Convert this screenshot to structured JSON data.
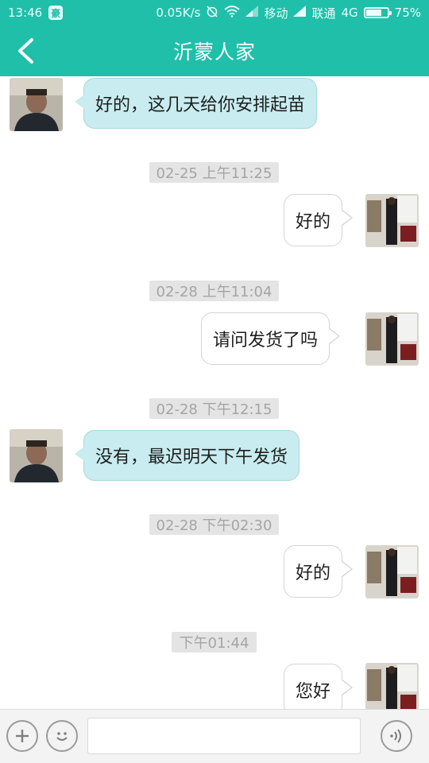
{
  "status_bar": {
    "time": "13:46",
    "app_badge": "豪",
    "network_speed": "0.05K/s",
    "carrier1": "移动",
    "carrier2": "联通",
    "network_type": "4G",
    "battery": "75%",
    "battery_level": 0.75,
    "icons": [
      "alarm-off-icon",
      "wifi-icon",
      "signal-icon",
      "signal-icon",
      "battery-icon"
    ]
  },
  "header": {
    "title": "沂蒙人家",
    "back_icon": "chevron-left-icon"
  },
  "messages": [
    {
      "kind": "in",
      "text": "好的，这几天给你安排起苗"
    },
    {
      "kind": "time",
      "text": "02-25 上午11:25"
    },
    {
      "kind": "out",
      "text": "好的"
    },
    {
      "kind": "time",
      "text": "02-28 上午11:04"
    },
    {
      "kind": "out",
      "text": "请问发货了吗"
    },
    {
      "kind": "time",
      "text": "02-28 下午12:15"
    },
    {
      "kind": "in",
      "text": "没有，最迟明天下午发货"
    },
    {
      "kind": "time",
      "text": "02-28 下午02:30"
    },
    {
      "kind": "out",
      "text": "好的"
    },
    {
      "kind": "time",
      "text": "下午01:44"
    },
    {
      "kind": "out",
      "text": "您好"
    }
  ],
  "input_bar": {
    "icons": [
      "plus-icon",
      "emoji-icon",
      "voice-icon"
    ],
    "text_value": ""
  },
  "colors": {
    "accent": "#1fbfaa",
    "incoming_bubble": "#c8ecef",
    "outgoing_bubble": "#ffffff",
    "timestamp_bg": "#e4e4e4"
  }
}
